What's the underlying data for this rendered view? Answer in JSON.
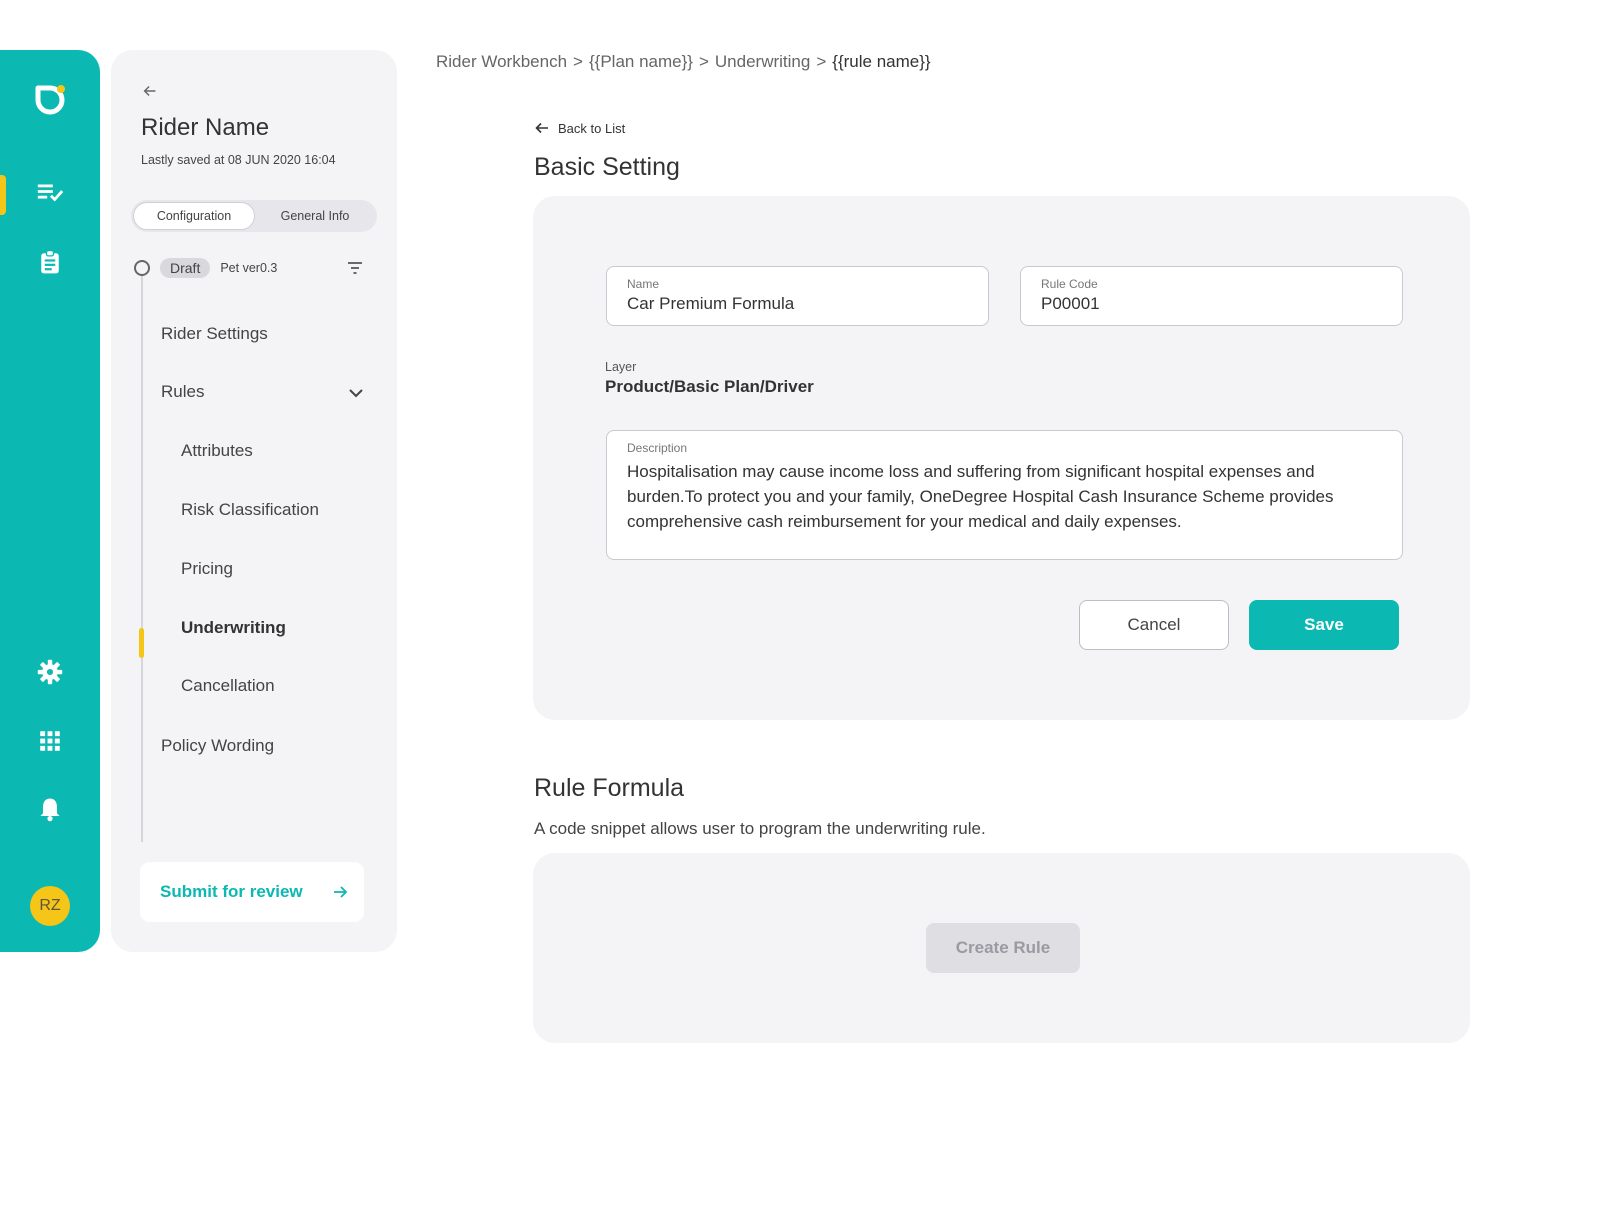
{
  "rail": {
    "avatar_initials": "RZ",
    "icons": [
      "logo-icon",
      "checklist-icon",
      "clipboard-icon",
      "gear-icon",
      "grid-icon",
      "bell-icon"
    ]
  },
  "panel": {
    "rider_name": "Rider Name",
    "saved_text": "Lastly saved at 08 JUN 2020 16:04",
    "segments": [
      "Configuration",
      "General Info"
    ],
    "draft_badge": "Draft",
    "version": "Pet ver0.3",
    "nav": {
      "rider_settings": "Rider Settings",
      "rules": "Rules",
      "attributes": "Attributes",
      "risk_classification": "Risk Classification",
      "pricing": "Pricing",
      "underwriting": "Underwriting",
      "cancellation": "Cancellation",
      "policy_wording": "Policy Wording"
    },
    "submit_label": "Submit for review"
  },
  "breadcrumb": {
    "items": [
      "Rider Workbench",
      ">",
      "{{Plan name}}",
      ">",
      "Underwriting",
      ">",
      "{{rule name}}"
    ]
  },
  "basic": {
    "back_label": "Back to List",
    "title": "Basic Setting",
    "name_label": "Name",
    "name_value": "Car Premium Formula",
    "code_label": "Rule Code",
    "code_value": "P00001",
    "layer_label": "Layer",
    "layer_value": "Product/Basic Plan/Driver",
    "desc_label": "Description",
    "desc_value": "Hospitalisation may cause income loss and suffering from significant hospital expenses and burden.To protect you and your family, OneDegree Hospital Cash Insurance Scheme provides comprehensive cash reimbursement for your medical and daily expenses.",
    "cancel_label": "Cancel",
    "save_label": "Save"
  },
  "formula": {
    "title": "Rule Formula",
    "subtitle": "A code snippet allows user to program the underwriting rule.",
    "create_label": "Create Rule"
  },
  "colors": {
    "accent": "#0bb8b2",
    "highlight": "#f5c518",
    "panel_bg": "#f4f4f7"
  }
}
